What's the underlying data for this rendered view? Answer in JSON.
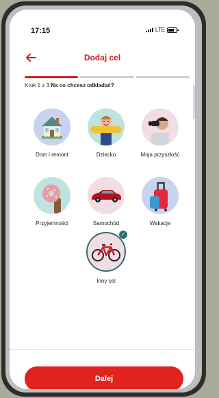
{
  "status_bar": {
    "time": "17:15",
    "network": "LTE"
  },
  "header": {
    "title": "Dodaj cel"
  },
  "progress": {
    "total_steps": 3,
    "current_step": 1
  },
  "step": {
    "prefix": "Krok 1 z 3",
    "question": "Na co chcesz odkładać?"
  },
  "goals": [
    {
      "label": "Dom i remont",
      "icon": "house-icon"
    },
    {
      "label": "Dziecko",
      "icon": "child-icon"
    },
    {
      "label": "Moja przyszłość",
      "icon": "binoculars-icon"
    },
    {
      "label": "Przyjemności",
      "icon": "donut-icon"
    },
    {
      "label": "Samochód",
      "icon": "car-icon"
    },
    {
      "label": "Wakacje",
      "icon": "suitcase-icon"
    },
    {
      "label": "Inny cel",
      "icon": "bicycle-icon",
      "selected": true
    }
  ],
  "cta": {
    "label": "Dalej"
  },
  "colors": {
    "accent": "#d31c24",
    "button": "#e0231f",
    "selected": "#2f6e70"
  }
}
